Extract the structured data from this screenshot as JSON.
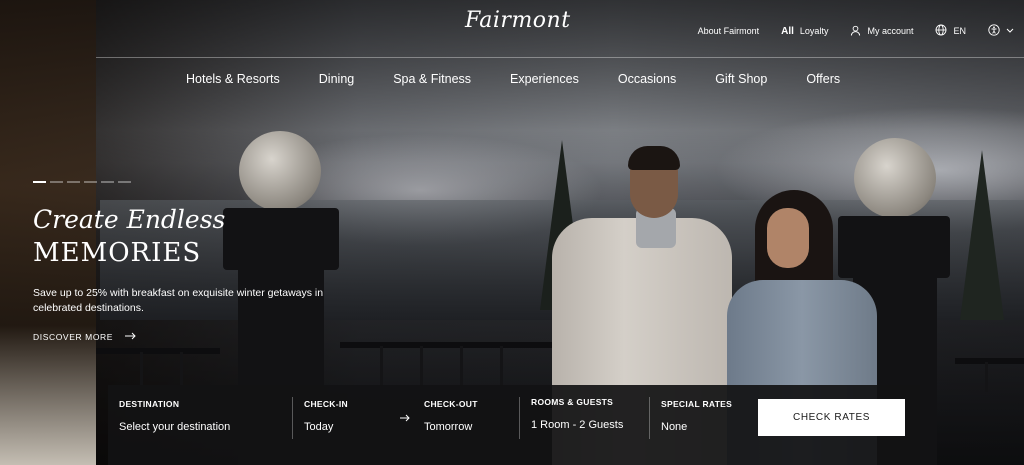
{
  "header": {
    "logo_text": "Fairmont",
    "links": [
      {
        "label": "About Fairmont"
      },
      {
        "label": "Loyalty",
        "prefix": "All"
      },
      {
        "label": "My account"
      },
      {
        "label": "EN"
      }
    ]
  },
  "main_nav": [
    "Hotels & Resorts",
    "Dining",
    "Spa & Fitness",
    "Experiences",
    "Occasions",
    "Gift Shop",
    "Offers"
  ],
  "hero": {
    "slides_count": 6,
    "active_slide": 1,
    "title_script": "Create Endless",
    "title_caps": "MEMORIES",
    "description": "Save up to 25% with breakfast on exquisite winter getaways in celebrated destinations.",
    "cta_label": "DISCOVER MORE"
  },
  "booking": {
    "destination": {
      "label": "DESTINATION",
      "value": "Select your destination"
    },
    "check_in": {
      "label": "CHECK-IN",
      "value": "Today"
    },
    "check_out": {
      "label": "CHECK-OUT",
      "value": "Tomorrow"
    },
    "rooms_guests": {
      "label": "ROOMS & GUESTS",
      "value": "1 Room - 2 Guests"
    },
    "special_rates": {
      "label": "SPECIAL RATES",
      "value": "None"
    },
    "submit_label": "CHECK RATES"
  },
  "icons": [
    "user-icon",
    "globe-icon",
    "accessibility-icon",
    "chevron-down-icon",
    "arrow-right-icon"
  ]
}
